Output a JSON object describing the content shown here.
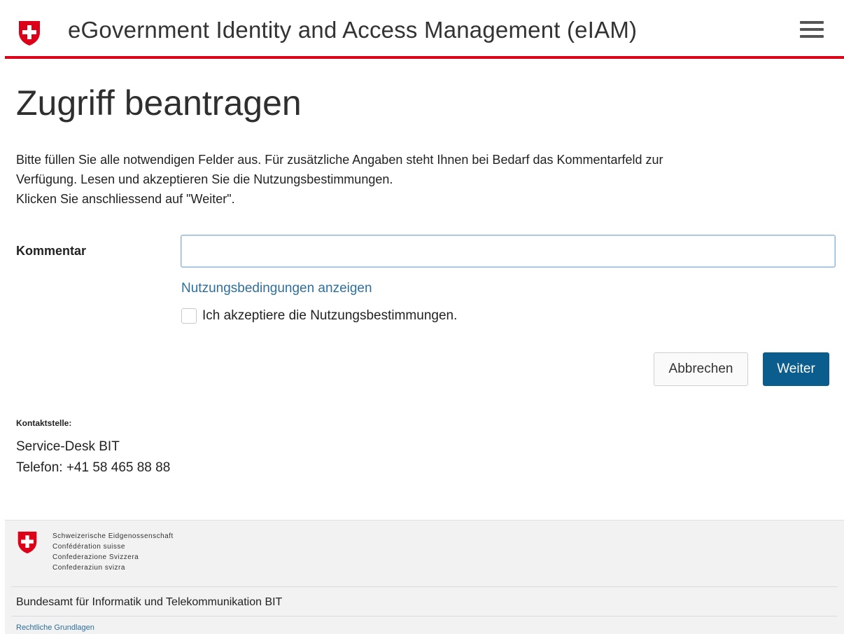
{
  "header": {
    "app_title": "eGovernment Identity and Access Management (eIAM)",
    "menu_icon": "hamburger-menu-icon",
    "accent_color": "#dc0018"
  },
  "main": {
    "page_title": "Zugriff beantragen",
    "intro_line1": "Bitte füllen Sie alle notwendigen Felder aus. Für zusätzliche Angaben steht Ihnen bei Bedarf das Kommentarfeld zur",
    "intro_line2": "Verfügung. Lesen und akzeptieren Sie die Nutzungsbestimmungen.",
    "intro_line3": "Klicken Sie anschliessend auf \"Weiter\".",
    "comment_label": "Kommentar",
    "comment_value": "",
    "terms_link": "Nutzungsbedingungen anzeigen",
    "accept_label": "Ich akzeptiere die Nutzungsbestimmungen.",
    "accept_checked": false,
    "cancel_label": "Abbrechen",
    "next_label": "Weiter",
    "primary_color": "#0a5d8d"
  },
  "contact": {
    "heading": "Kontaktstelle:",
    "name": "Service-Desk BIT",
    "phone": "Telefon: +41 58 465 88 88"
  },
  "footer": {
    "confederation_de": "Schweizerische Eidgenossenschaft",
    "confederation_fr": "Confédération suisse",
    "confederation_it": "Confederazione Svizzera",
    "confederation_rm": "Confederaziun svizra",
    "office": "Bundesamt für Informatik und Telekommunikation BIT",
    "legal_link": "Rechtliche Grundlagen"
  }
}
